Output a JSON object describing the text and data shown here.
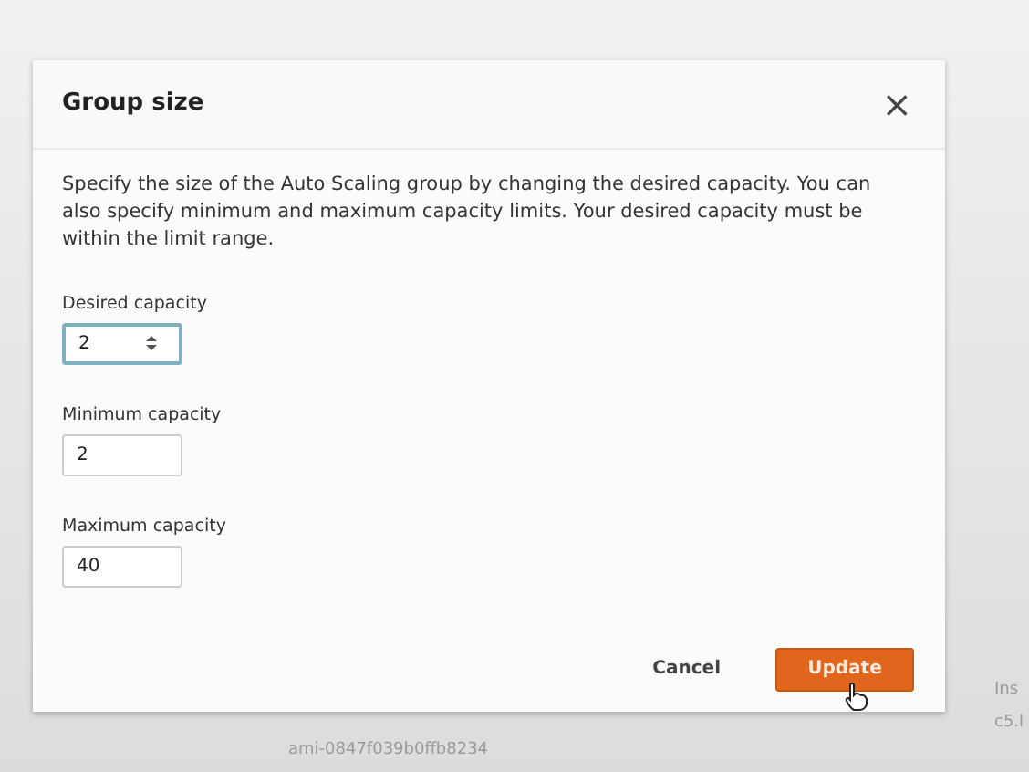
{
  "dialog": {
    "title": "Group size",
    "close": "×",
    "description": "Specify the size of the Auto Scaling group by changing the desired capacity. You can also specify minimum and maximum capacity limits. Your desired capacity must be within the limit range.",
    "fields": [
      {
        "label": "Desired capacity",
        "value": "2",
        "kind": "spinner",
        "focused": true
      },
      {
        "label": "Minimum capacity",
        "value": "2",
        "kind": "text",
        "focused": false
      },
      {
        "label": "Maximum capacity",
        "value": "40",
        "kind": "text",
        "focused": false
      }
    ],
    "buttons": [
      {
        "label": "Cancel",
        "kind": "link"
      },
      {
        "label": "Update",
        "kind": "primary"
      }
    ]
  },
  "background": {
    "ami_id": "ami-0847f039b0ffb8234",
    "column_fragments": [
      "Ins",
      "c5.l"
    ]
  }
}
